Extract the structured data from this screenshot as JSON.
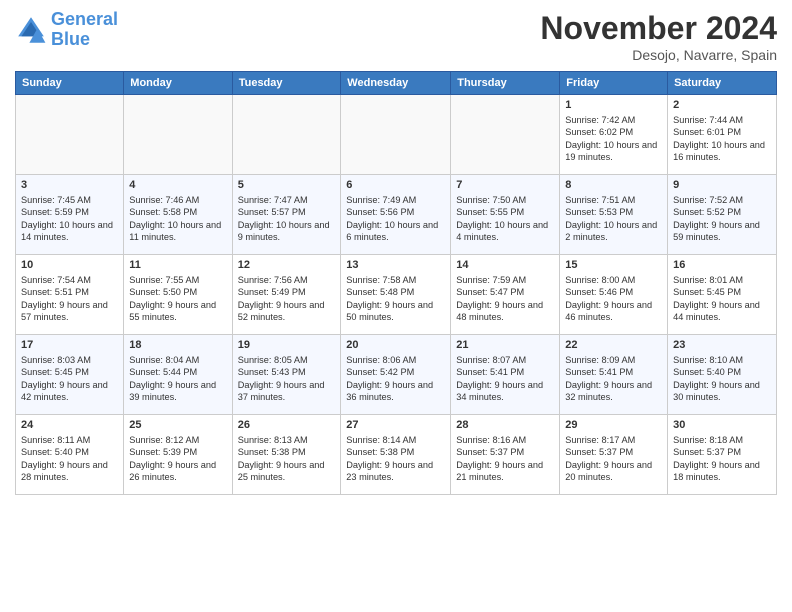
{
  "logo": {
    "line1": "General",
    "line2": "Blue"
  },
  "title": "November 2024",
  "subtitle": "Desojo, Navarre, Spain",
  "days_header": [
    "Sunday",
    "Monday",
    "Tuesday",
    "Wednesday",
    "Thursday",
    "Friday",
    "Saturday"
  ],
  "weeks": [
    [
      {
        "day": "",
        "info": ""
      },
      {
        "day": "",
        "info": ""
      },
      {
        "day": "",
        "info": ""
      },
      {
        "day": "",
        "info": ""
      },
      {
        "day": "",
        "info": ""
      },
      {
        "day": "1",
        "info": "Sunrise: 7:42 AM\nSunset: 6:02 PM\nDaylight: 10 hours and 19 minutes."
      },
      {
        "day": "2",
        "info": "Sunrise: 7:44 AM\nSunset: 6:01 PM\nDaylight: 10 hours and 16 minutes."
      }
    ],
    [
      {
        "day": "3",
        "info": "Sunrise: 7:45 AM\nSunset: 5:59 PM\nDaylight: 10 hours and 14 minutes."
      },
      {
        "day": "4",
        "info": "Sunrise: 7:46 AM\nSunset: 5:58 PM\nDaylight: 10 hours and 11 minutes."
      },
      {
        "day": "5",
        "info": "Sunrise: 7:47 AM\nSunset: 5:57 PM\nDaylight: 10 hours and 9 minutes."
      },
      {
        "day": "6",
        "info": "Sunrise: 7:49 AM\nSunset: 5:56 PM\nDaylight: 10 hours and 6 minutes."
      },
      {
        "day": "7",
        "info": "Sunrise: 7:50 AM\nSunset: 5:55 PM\nDaylight: 10 hours and 4 minutes."
      },
      {
        "day": "8",
        "info": "Sunrise: 7:51 AM\nSunset: 5:53 PM\nDaylight: 10 hours and 2 minutes."
      },
      {
        "day": "9",
        "info": "Sunrise: 7:52 AM\nSunset: 5:52 PM\nDaylight: 9 hours and 59 minutes."
      }
    ],
    [
      {
        "day": "10",
        "info": "Sunrise: 7:54 AM\nSunset: 5:51 PM\nDaylight: 9 hours and 57 minutes."
      },
      {
        "day": "11",
        "info": "Sunrise: 7:55 AM\nSunset: 5:50 PM\nDaylight: 9 hours and 55 minutes."
      },
      {
        "day": "12",
        "info": "Sunrise: 7:56 AM\nSunset: 5:49 PM\nDaylight: 9 hours and 52 minutes."
      },
      {
        "day": "13",
        "info": "Sunrise: 7:58 AM\nSunset: 5:48 PM\nDaylight: 9 hours and 50 minutes."
      },
      {
        "day": "14",
        "info": "Sunrise: 7:59 AM\nSunset: 5:47 PM\nDaylight: 9 hours and 48 minutes."
      },
      {
        "day": "15",
        "info": "Sunrise: 8:00 AM\nSunset: 5:46 PM\nDaylight: 9 hours and 46 minutes."
      },
      {
        "day": "16",
        "info": "Sunrise: 8:01 AM\nSunset: 5:45 PM\nDaylight: 9 hours and 44 minutes."
      }
    ],
    [
      {
        "day": "17",
        "info": "Sunrise: 8:03 AM\nSunset: 5:45 PM\nDaylight: 9 hours and 42 minutes."
      },
      {
        "day": "18",
        "info": "Sunrise: 8:04 AM\nSunset: 5:44 PM\nDaylight: 9 hours and 39 minutes."
      },
      {
        "day": "19",
        "info": "Sunrise: 8:05 AM\nSunset: 5:43 PM\nDaylight: 9 hours and 37 minutes."
      },
      {
        "day": "20",
        "info": "Sunrise: 8:06 AM\nSunset: 5:42 PM\nDaylight: 9 hours and 36 minutes."
      },
      {
        "day": "21",
        "info": "Sunrise: 8:07 AM\nSunset: 5:41 PM\nDaylight: 9 hours and 34 minutes."
      },
      {
        "day": "22",
        "info": "Sunrise: 8:09 AM\nSunset: 5:41 PM\nDaylight: 9 hours and 32 minutes."
      },
      {
        "day": "23",
        "info": "Sunrise: 8:10 AM\nSunset: 5:40 PM\nDaylight: 9 hours and 30 minutes."
      }
    ],
    [
      {
        "day": "24",
        "info": "Sunrise: 8:11 AM\nSunset: 5:40 PM\nDaylight: 9 hours and 28 minutes."
      },
      {
        "day": "25",
        "info": "Sunrise: 8:12 AM\nSunset: 5:39 PM\nDaylight: 9 hours and 26 minutes."
      },
      {
        "day": "26",
        "info": "Sunrise: 8:13 AM\nSunset: 5:38 PM\nDaylight: 9 hours and 25 minutes."
      },
      {
        "day": "27",
        "info": "Sunrise: 8:14 AM\nSunset: 5:38 PM\nDaylight: 9 hours and 23 minutes."
      },
      {
        "day": "28",
        "info": "Sunrise: 8:16 AM\nSunset: 5:37 PM\nDaylight: 9 hours and 21 minutes."
      },
      {
        "day": "29",
        "info": "Sunrise: 8:17 AM\nSunset: 5:37 PM\nDaylight: 9 hours and 20 minutes."
      },
      {
        "day": "30",
        "info": "Sunrise: 8:18 AM\nSunset: 5:37 PM\nDaylight: 9 hours and 18 minutes."
      }
    ]
  ]
}
